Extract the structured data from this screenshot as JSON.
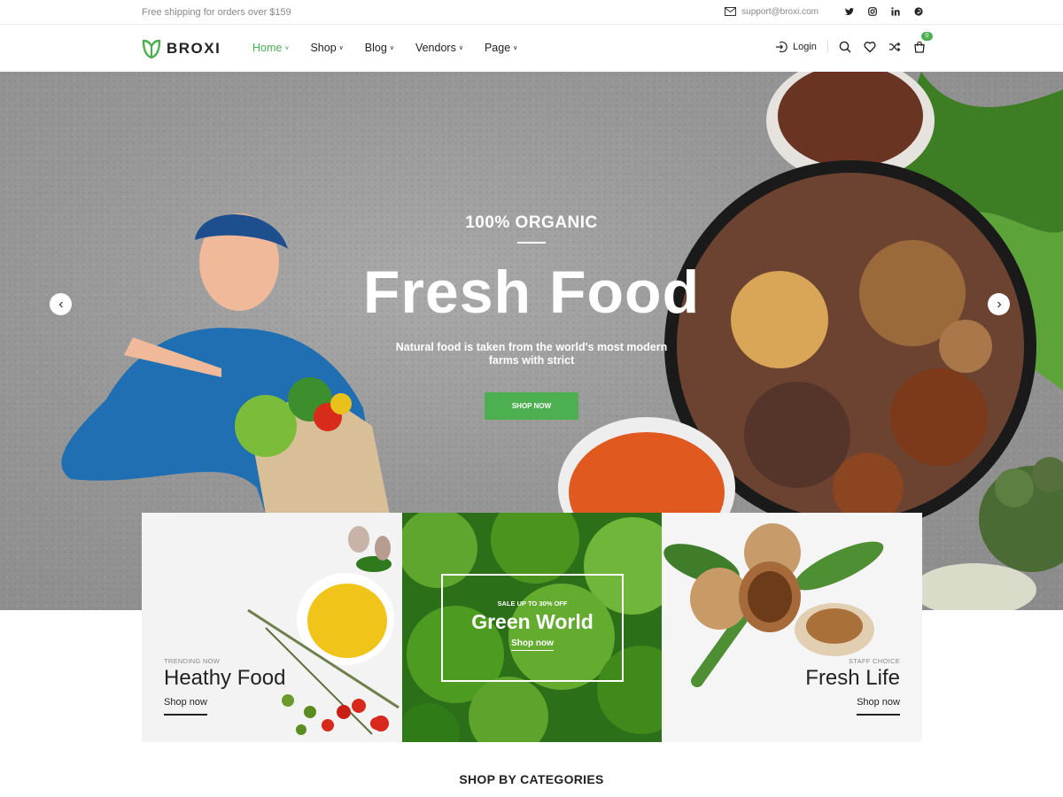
{
  "topbar": {
    "shipping_text": "Free shipping for orders over $159",
    "email": "support@broxi.com",
    "social_icons": [
      "twitter-icon",
      "instagram-icon",
      "linkedin-icon",
      "pinterest-icon"
    ]
  },
  "header": {
    "logo_text": "BROXI",
    "nav": [
      {
        "label": "Home",
        "active": true
      },
      {
        "label": "Shop",
        "active": false
      },
      {
        "label": "Blog",
        "active": false
      },
      {
        "label": "Vendors",
        "active": false
      },
      {
        "label": "Page",
        "active": false
      }
    ],
    "login_label": "Login",
    "cart_count": "0"
  },
  "hero": {
    "kicker": "100% ORGANIC",
    "title": "Fresh Food",
    "subtitle_line1": "Natural food is taken from the world's most modern",
    "subtitle_line2": "farms with strict",
    "button_label": "SHOP NOW"
  },
  "banners": [
    {
      "kicker": "TRENDING NOW",
      "title": "Heathy Food",
      "link": "Shop now"
    },
    {
      "kicker": "SALE UP TO 30% OFF",
      "title": "Green World",
      "link": "Shop now"
    },
    {
      "kicker": "STAFF CHOICE",
      "title": "Fresh Life",
      "link": "Shop now"
    }
  ],
  "section": {
    "title": "SHOP BY CATEGORIES"
  },
  "colors": {
    "accent": "#4caf50",
    "text": "#222222",
    "muted": "#888888"
  }
}
